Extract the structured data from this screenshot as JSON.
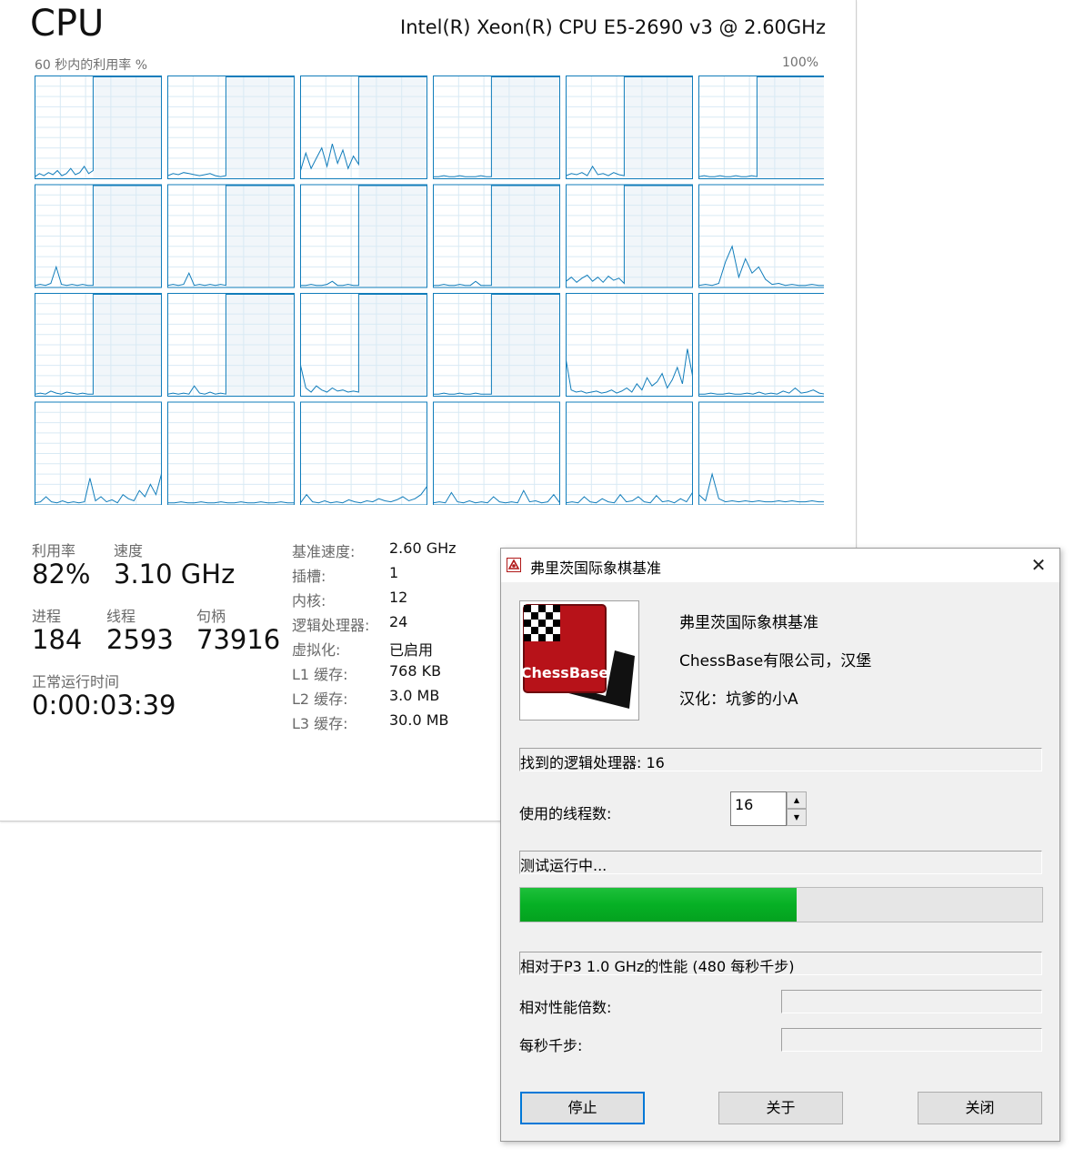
{
  "task_manager": {
    "title": "CPU",
    "cpu_model": "Intel(R) Xeon(R) CPU E5-2690 v3 @ 2.60GHz",
    "graph_label": "60 秒内的利用率 %",
    "graph_max": "100%",
    "colors": {
      "line": "#117dbb",
      "fill": "#f1f6fa",
      "grid": "#d9eaf4"
    },
    "stats": {
      "utilization_label": "利用率",
      "utilization": "82%",
      "speed_label": "速度",
      "speed": "3.10 GHz",
      "processes_label": "进程",
      "processes": "184",
      "threads_label": "线程",
      "threads": "2593",
      "handles_label": "句柄",
      "handles": "73916",
      "uptime_label": "正常运行时间",
      "uptime": "0:00:03:39"
    },
    "details": [
      {
        "label": "基准速度:",
        "value": "2.60 GHz"
      },
      {
        "label": "插槽:",
        "value": "1"
      },
      {
        "label": "内核:",
        "value": "12"
      },
      {
        "label": "逻辑处理器:",
        "value": "24"
      },
      {
        "label": "虚拟化:",
        "value": "已启用"
      },
      {
        "label": "L1 缓存:",
        "value": "768 KB"
      },
      {
        "label": "L2 缓存:",
        "value": "3.0 MB"
      },
      {
        "label": "L3 缓存:",
        "value": "30.0 MB"
      }
    ],
    "core_graphs": [
      {
        "load_start": 0.46,
        "idle": [
          2,
          5,
          3,
          6,
          4,
          8,
          3,
          5,
          10,
          4,
          6,
          12,
          5,
          8
        ]
      },
      {
        "load_start": 0.46,
        "idle": [
          3,
          5,
          4,
          6,
          5,
          4,
          3,
          4,
          5,
          3,
          2,
          3
        ]
      },
      {
        "load_start": 0.46,
        "idle": [
          8,
          25,
          10,
          20,
          30,
          12,
          34,
          15,
          28,
          10,
          22,
          14
        ]
      },
      {
        "load_start": 0.46,
        "idle": [
          2,
          2,
          3,
          2,
          2,
          3,
          2,
          2,
          2,
          3,
          2,
          2
        ]
      },
      {
        "load_start": 0.46,
        "idle": [
          3,
          5,
          4,
          6,
          3,
          12,
          4,
          5,
          3,
          6,
          4,
          3
        ]
      },
      {
        "load_start": 0.46,
        "idle": [
          2,
          3,
          2,
          2,
          3,
          2,
          2,
          3,
          2,
          2,
          3,
          2
        ]
      },
      {
        "load_start": 0.46,
        "idle": [
          2,
          3,
          2,
          4,
          20,
          3,
          2,
          3,
          2,
          3,
          2,
          2
        ]
      },
      {
        "load_start": 0.46,
        "idle": [
          2,
          3,
          2,
          3,
          14,
          2,
          3,
          2,
          3,
          2,
          3,
          2
        ]
      },
      {
        "load_start": 0.46,
        "idle": [
          2,
          2,
          3,
          2,
          2,
          3,
          6,
          2,
          2,
          3,
          2,
          2
        ]
      },
      {
        "load_start": 0.46,
        "idle": [
          2,
          2,
          3,
          2,
          2,
          3,
          2,
          2,
          6,
          2,
          2,
          2
        ]
      },
      {
        "load_start": 0.46,
        "idle": [
          6,
          10,
          5,
          9,
          12,
          6,
          10,
          5,
          11,
          7,
          9,
          4
        ]
      },
      {
        "load_start": 1.0,
        "idle": [
          2,
          3,
          2,
          4,
          25,
          40,
          10,
          28,
          14,
          20,
          8,
          3,
          4,
          2,
          3,
          2,
          2,
          3,
          2,
          2
        ]
      },
      {
        "load_start": 0.46,
        "idle": [
          2,
          3,
          2,
          5,
          3,
          2,
          4,
          3,
          2,
          3,
          2,
          2
        ]
      },
      {
        "load_start": 0.46,
        "idle": [
          2,
          3,
          2,
          3,
          2,
          10,
          3,
          2,
          4,
          2,
          3,
          2
        ]
      },
      {
        "load_start": 0.46,
        "idle": [
          30,
          8,
          4,
          10,
          6,
          4,
          8,
          5,
          6,
          4,
          5,
          4
        ]
      },
      {
        "load_start": 0.46,
        "idle": [
          2,
          2,
          3,
          2,
          2,
          3,
          2,
          2,
          3,
          2,
          2,
          2
        ]
      },
      {
        "load_start": 1.0,
        "idle": [
          35,
          6,
          4,
          5,
          3,
          4,
          5,
          3,
          4,
          6,
          3,
          5,
          8,
          4,
          12,
          6,
          18,
          10,
          14,
          22,
          8,
          16,
          28,
          12,
          46,
          20
        ]
      },
      {
        "load_start": 1.0,
        "idle": [
          2,
          2,
          3,
          2,
          2,
          3,
          2,
          2,
          3,
          2,
          4,
          2,
          3,
          2,
          5,
          3,
          8,
          3,
          4,
          6,
          3,
          2
        ]
      },
      {
        "load_start": 1.0,
        "idle": [
          2,
          3,
          8,
          3,
          2,
          4,
          2,
          3,
          2,
          3,
          26,
          4,
          8,
          3,
          5,
          2,
          10,
          6,
          4,
          14,
          8,
          20,
          10,
          30
        ]
      },
      {
        "load_start": 1.0,
        "idle": [
          2,
          2,
          3,
          2,
          2,
          3,
          2,
          2,
          3,
          2,
          2,
          3,
          2,
          2,
          3,
          2,
          2,
          3,
          2,
          2
        ]
      },
      {
        "load_start": 1.0,
        "idle": [
          2,
          10,
          3,
          2,
          4,
          2,
          3,
          2,
          5,
          3,
          2,
          4,
          3,
          6,
          4,
          3,
          5,
          8,
          4,
          6,
          10,
          18
        ]
      },
      {
        "load_start": 1.0,
        "idle": [
          2,
          3,
          2,
          12,
          3,
          2,
          4,
          2,
          3,
          2,
          8,
          3,
          2,
          3,
          2,
          14,
          3,
          4,
          2,
          3,
          10,
          2
        ]
      },
      {
        "load_start": 1.0,
        "idle": [
          2,
          3,
          2,
          8,
          3,
          2,
          6,
          3,
          2,
          10,
          3,
          4,
          8,
          3,
          2,
          9,
          3,
          4,
          2,
          6,
          3,
          12
        ]
      },
      {
        "load_start": 1.0,
        "idle": [
          10,
          4,
          30,
          6,
          3,
          4,
          3,
          4,
          3,
          4,
          3,
          3,
          4,
          3,
          4,
          3,
          3,
          4,
          3,
          3
        ]
      }
    ]
  },
  "benchmark": {
    "window_title": "弗里茨国际象棋基准",
    "close_glyph": "✕",
    "logo_text": "ChessBase",
    "app_name": "弗里茨国际象棋基准",
    "company": "ChessBase有限公司，汉堡",
    "localized_by": "汉化：坑爹的小A",
    "logical_processors_found": "找到的逻辑处理器: 16",
    "threads_label": "使用的线程数:",
    "threads_value": "16",
    "status_text": "测试运行中...",
    "progress": 0.53,
    "progress_color": "#06b025",
    "reference_text": "相对于P3 1.0 GHz的性能 (480 每秒千步)",
    "relative_factor_label": "相对性能倍数:",
    "knps_label": "每秒千步:",
    "buttons": {
      "stop": "停止",
      "about": "关于",
      "close": "关闭"
    }
  }
}
